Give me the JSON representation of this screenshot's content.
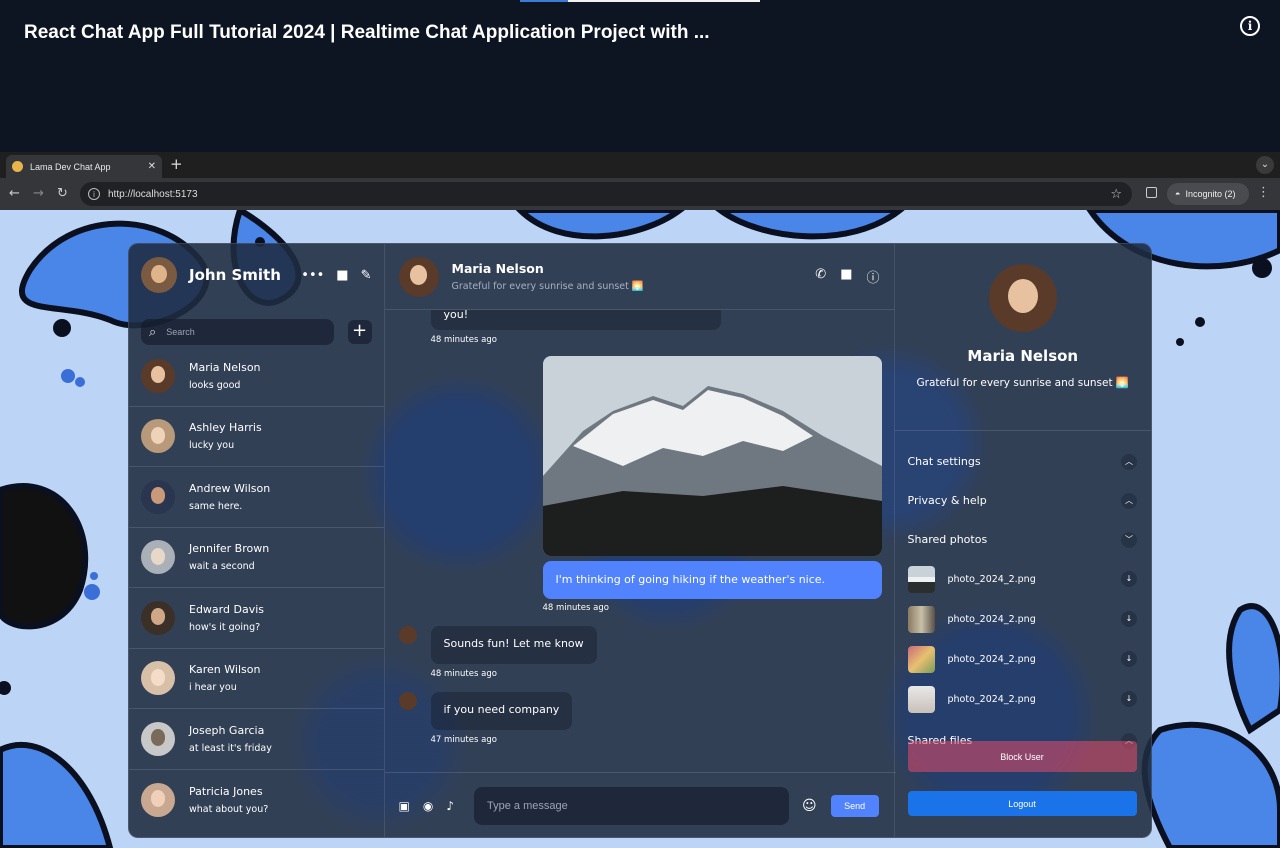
{
  "video": {
    "title": "React Chat App Full Tutorial 2024 | Realtime Chat Application Project with ..."
  },
  "browser": {
    "tab_title": "Lama Dev Chat App",
    "url": "http://localhost:5173",
    "incognito_label": "Incognito (2)"
  },
  "colors": {
    "accent": "#5183fe",
    "logout": "#1a73e8",
    "block": "#e64a69",
    "panel": "#1f2b40"
  },
  "user": {
    "name": "John Smith"
  },
  "search": {
    "placeholder": "Search"
  },
  "chats": [
    {
      "name": "Maria Nelson",
      "last": "looks good"
    },
    {
      "name": "Ashley Harris",
      "last": "lucky you"
    },
    {
      "name": "Andrew Wilson",
      "last": "same here."
    },
    {
      "name": "Jennifer Brown",
      "last": "wait a second"
    },
    {
      "name": "Edward Davis",
      "last": "how's it going?"
    },
    {
      "name": "Karen Wilson",
      "last": "i hear you"
    },
    {
      "name": "Joseph Garcia",
      "last": "at least it's friday"
    },
    {
      "name": "Patricia Jones",
      "last": "what about you?"
    }
  ],
  "active_chat": {
    "name": "Maria Nelson",
    "status": "Grateful for every sunrise and sunset 🌅"
  },
  "messages": {
    "m0_text": "you!",
    "m0_time": "48 minutes ago",
    "own_text": "I'm thinking of going hiking if the weather's nice.",
    "own_time": "48 minutes ago",
    "m2_text": "Sounds fun! Let me know",
    "m2_time": "48 minutes ago",
    "m3_text": "if you need company",
    "m3_time": "47 minutes ago"
  },
  "composer": {
    "placeholder": "Type a message",
    "send_label": "Send"
  },
  "detail": {
    "name": "Maria Nelson",
    "status": "Grateful for every sunrise and sunset 🌅",
    "options": {
      "chat_settings": "Chat settings",
      "privacy": "Privacy & help",
      "shared_photos": "Shared photos",
      "shared_files": "Shared files"
    },
    "photos": [
      {
        "name": "photo_2024_2.png"
      },
      {
        "name": "photo_2024_2.png"
      },
      {
        "name": "photo_2024_2.png"
      },
      {
        "name": "photo_2024_2.png"
      }
    ],
    "block_label": "Block User",
    "logout_label": "Logout"
  }
}
